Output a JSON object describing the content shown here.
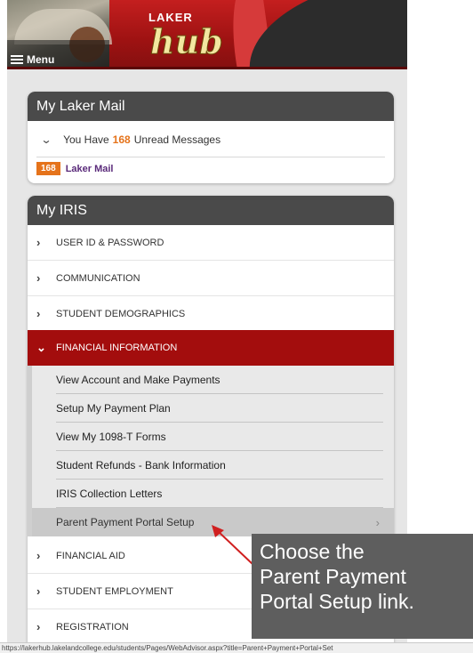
{
  "header": {
    "logo_top": "LAKER",
    "logo_main": "hub",
    "menu_label": "Menu"
  },
  "mail_panel": {
    "title": "My Laker Mail",
    "unread_prefix": "You Have",
    "unread_count": "168",
    "unread_suffix": "Unread Messages",
    "badge_count": "168",
    "link_label": "Laker Mail"
  },
  "iris_panel": {
    "title": "My IRIS",
    "items": [
      {
        "label": "USER ID & PASSWORD"
      },
      {
        "label": "COMMUNICATION"
      },
      {
        "label": "STUDENT DEMOGRAPHICS"
      },
      {
        "label": "FINANCIAL INFORMATION",
        "expanded": true
      },
      {
        "label": "FINANCIAL AID"
      },
      {
        "label": "STUDENT EMPLOYMENT"
      },
      {
        "label": "REGISTRATION"
      }
    ],
    "financial_subitems": [
      {
        "label": "View Account and Make Payments"
      },
      {
        "label": "Setup My Payment Plan"
      },
      {
        "label": "View My 1098-T Forms"
      },
      {
        "label": "Student Refunds - Bank Information"
      },
      {
        "label": "IRIS Collection Letters"
      },
      {
        "label": "Parent Payment Portal Setup",
        "highlighted": true
      }
    ]
  },
  "callout": {
    "text_line1": "Choose the",
    "text_line2": "Parent Payment",
    "text_line3": "Portal Setup link."
  },
  "status_bar": {
    "url": "https://lakerhub.lakelandcollege.edu/students/Pages/WebAdvisor.aspx?title=Parent+Payment+Portal+Set"
  },
  "colors": {
    "header_red": "#a30d0d",
    "accent_orange": "#e5731b",
    "panel_header": "#4a4a4a",
    "callout_bg": "#5e5e5e"
  }
}
